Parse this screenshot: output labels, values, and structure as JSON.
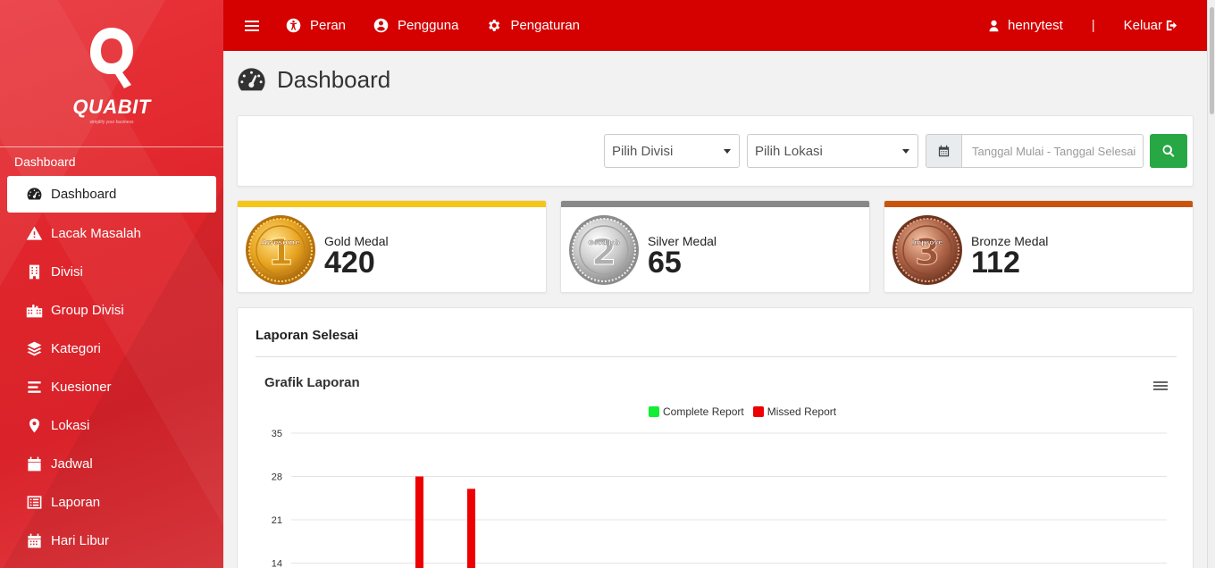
{
  "brand": {
    "name": "QUABIT",
    "tagline": "simplify your business"
  },
  "sidebar": {
    "section_label": "Dashboard",
    "items": [
      {
        "label": "Dashboard",
        "icon": "tachometer-icon",
        "active": true
      },
      {
        "label": "Lacak Masalah",
        "icon": "warning-icon"
      },
      {
        "label": "Divisi",
        "icon": "building-icon"
      },
      {
        "label": "Group Divisi",
        "icon": "city-icon"
      },
      {
        "label": "Kategori",
        "icon": "layers-icon"
      },
      {
        "label": "Kuesioner",
        "icon": "list-icon"
      },
      {
        "label": "Lokasi",
        "icon": "map-marker-icon"
      },
      {
        "label": "Jadwal",
        "icon": "calendar-icon"
      },
      {
        "label": "Laporan",
        "icon": "list-alt-icon"
      },
      {
        "label": "Hari Libur",
        "icon": "calendar-alt-icon"
      }
    ]
  },
  "topbar": {
    "menu": [
      {
        "label": "Peran",
        "icon": "universal-access-icon"
      },
      {
        "label": "Pengguna",
        "icon": "user-circle-icon"
      },
      {
        "label": "Pengaturan",
        "icon": "gear-icon"
      }
    ],
    "username": "henrytest",
    "separator": "|",
    "logout_label": "Keluar"
  },
  "page": {
    "title": "Dashboard"
  },
  "filters": {
    "division_placeholder": "Pilih Divisi",
    "location_placeholder": "Pilih Lokasi",
    "date_placeholder": "Tanggal Mulai - Tanggal Selesai"
  },
  "medals": [
    {
      "label": "Gold Medal",
      "value": "420",
      "color": "#f5c518",
      "emblem": "1",
      "ribbon": "Awesome"
    },
    {
      "label": "Silver Medal",
      "value": "65",
      "color": "#888888",
      "emblem": "2",
      "ribbon": "Good Job"
    },
    {
      "label": "Bronze Medal",
      "value": "112",
      "color": "#c9540e",
      "emblem": "3",
      "ribbon": "Improve"
    }
  ],
  "report": {
    "title": "Laporan Selesai",
    "chart_title": "Grafik Laporan"
  },
  "chart_data": {
    "type": "bar",
    "title": "Grafik Laporan",
    "ylim": [
      0,
      35
    ],
    "y_ticks": [
      14,
      21,
      28,
      35
    ],
    "grid": true,
    "legend_position": "top",
    "series": [
      {
        "name": "Complete Report",
        "color": "#11ee33",
        "values": []
      },
      {
        "name": "Missed Report",
        "color": "#ee0000",
        "values": [
          28,
          26
        ]
      }
    ]
  }
}
